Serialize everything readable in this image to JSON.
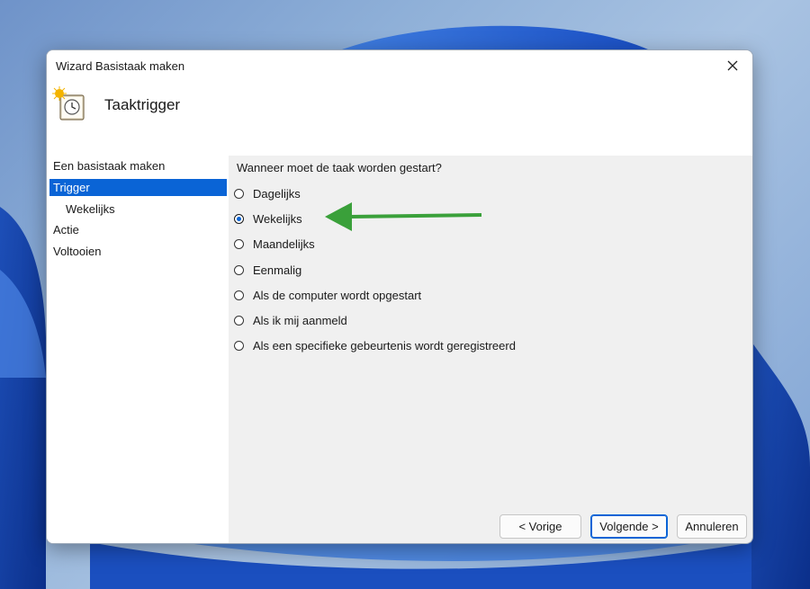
{
  "window": {
    "title": "Wizard Basistaak maken"
  },
  "header": {
    "title": "Taaktrigger",
    "icon": "task-clock-icon"
  },
  "sidebar": {
    "items": [
      {
        "label": "Een basistaak maken",
        "selected": false,
        "sub": false
      },
      {
        "label": "Trigger",
        "selected": true,
        "sub": false
      },
      {
        "label": "Wekelijks",
        "selected": false,
        "sub": true
      },
      {
        "label": "Actie",
        "selected": false,
        "sub": false
      },
      {
        "label": "Voltooien",
        "selected": false,
        "sub": false
      }
    ]
  },
  "main": {
    "question": "Wanneer moet de taak worden gestart?",
    "options": [
      {
        "label": "Dagelijks",
        "checked": false
      },
      {
        "label": "Wekelijks",
        "checked": true
      },
      {
        "label": "Maandelijks",
        "checked": false
      },
      {
        "label": "Eenmalig",
        "checked": false
      },
      {
        "label": "Als de computer wordt opgestart",
        "checked": false
      },
      {
        "label": "Als ik mij aanmeld",
        "checked": false
      },
      {
        "label": "Als een specifieke gebeurtenis wordt geregistreerd",
        "checked": false
      }
    ]
  },
  "buttons": {
    "back": "< Vorige",
    "next": "Volgende >",
    "cancel": "Annuleren"
  },
  "colors": {
    "accent": "#0a64d6",
    "annotation_arrow": "#3aa03a"
  }
}
